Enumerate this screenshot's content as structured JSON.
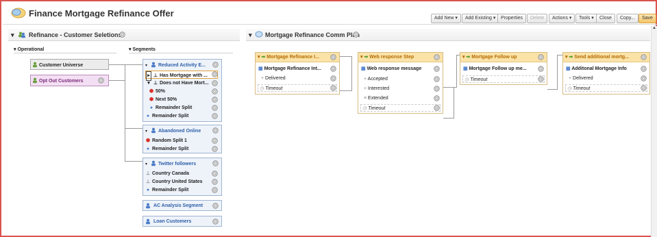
{
  "app": {
    "title": "Finance Mortgage Refinance Offer"
  },
  "toolbar": {
    "add_new": "Add New ▾",
    "add_existing": "Add Existing ▾",
    "properties": "Properties",
    "delete": "Delete",
    "actions": "Actions ▾",
    "tools": "Tools ▾",
    "close": "Close",
    "copy": "Copy...",
    "save": "Save"
  },
  "left_panel": {
    "title": "Refinance - Customer Seletions",
    "col_operational": "Operational",
    "col_segments": "Segments",
    "operational": [
      {
        "label": "Customer Universe"
      },
      {
        "label": "Opt Out Customers"
      }
    ],
    "segments": [
      {
        "title": "Reduced Activity E...",
        "rows": [
          "Has Mortgage with ...",
          "Does not Have Mort...",
          "50%",
          "Next 50%",
          "Remainder Split",
          "Remainder Split"
        ]
      },
      {
        "title": "Abandoned Online",
        "rows": [
          "Random Split 1",
          "Remainder Split"
        ]
      },
      {
        "title": "Twitter followers",
        "rows": [
          "Country Canada",
          "Country United States",
          "Remainder Split"
        ]
      },
      {
        "title": "AC Analysis Segment",
        "rows": []
      },
      {
        "title": "Loan Customers",
        "rows": []
      }
    ]
  },
  "right_panel": {
    "title": "Mortgage Refinance Comm Plan",
    "steps": [
      {
        "title": "Mortgage Refinance I...",
        "message": "Mortgage Refinance Int...",
        "responses": [
          "Delivered"
        ],
        "timeout": "Timeout"
      },
      {
        "title": "Web response Step",
        "message": "Web response message",
        "responses": [
          "Accepted",
          "Interested",
          "Extended"
        ],
        "timeout": "Timeout"
      },
      {
        "title": "Mortgage Follow up",
        "message": "Mortgage Follow up me...",
        "responses": [],
        "timeout": "Timeout"
      },
      {
        "title": "Send additional mortg...",
        "message": "Additonal Mortgage Info",
        "responses": [
          "Delivered"
        ],
        "timeout": "Timeout"
      }
    ]
  },
  "colors": {
    "frame_border": "#d9534f",
    "segment_title": "#2c5ea8",
    "step_header": "#fbe3a8",
    "step_title": "#b46a00",
    "opt_out_bg": "#f3dff3"
  },
  "icons": {
    "gear": "gear-icon",
    "person": "person-icon",
    "split": "split-icon",
    "step_arrow": "arrow-right-icon"
  }
}
